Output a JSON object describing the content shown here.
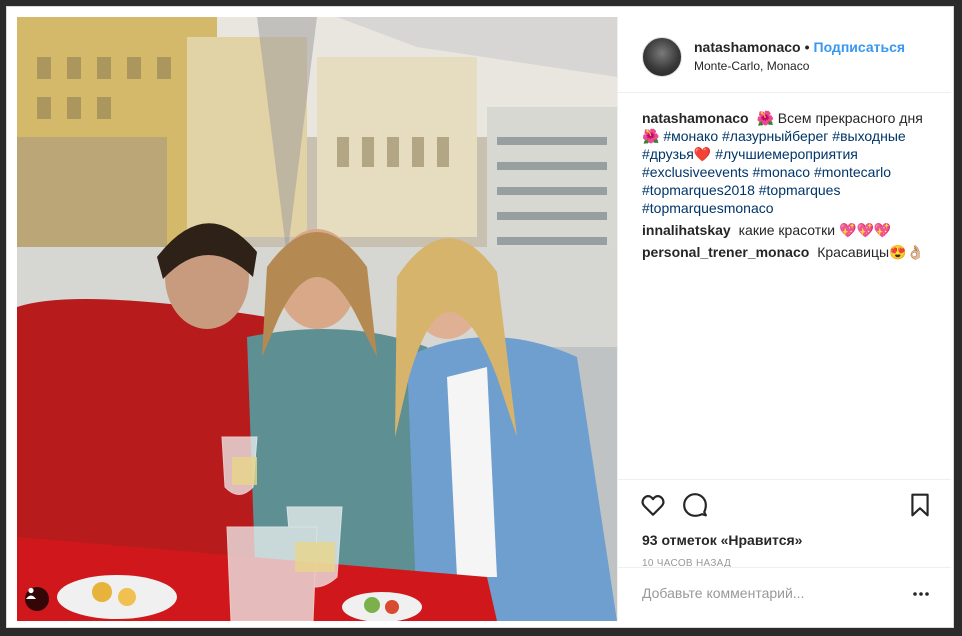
{
  "post": {
    "username": "natashamonaco",
    "separator": "•",
    "follow_label": "Подписаться",
    "location": "Monte-Carlo, Monaco",
    "caption": {
      "username": "natashamonaco",
      "text_1": "🌺 Всем прекрасного дня 🌺",
      "hashtags_1": "#монако #лазурныйберег #выходные #друзья",
      "emoji_1": "❤️",
      "hashtags_2": "#лучшиемероприятия #exclusiveevents #monaco #montecarlo #topmarques2018 #topmarques #topmarquesmonaco"
    },
    "comments": [
      {
        "username": "innalihatskay",
        "text": "какие красотки 💖💖💖"
      },
      {
        "username": "personal_trener_monaco",
        "text": "Красавицы😍👌🏼"
      }
    ],
    "likes_label": "93 отметок «Нравится»",
    "time_label": "10 ЧАСОВ НАЗАД",
    "comment_placeholder": "Добавьте комментарий...",
    "icons": {
      "like": "heart-icon",
      "comment": "comment-icon",
      "save": "bookmark-icon",
      "more": "more-icon",
      "user_tag": "user-tag-icon"
    }
  }
}
